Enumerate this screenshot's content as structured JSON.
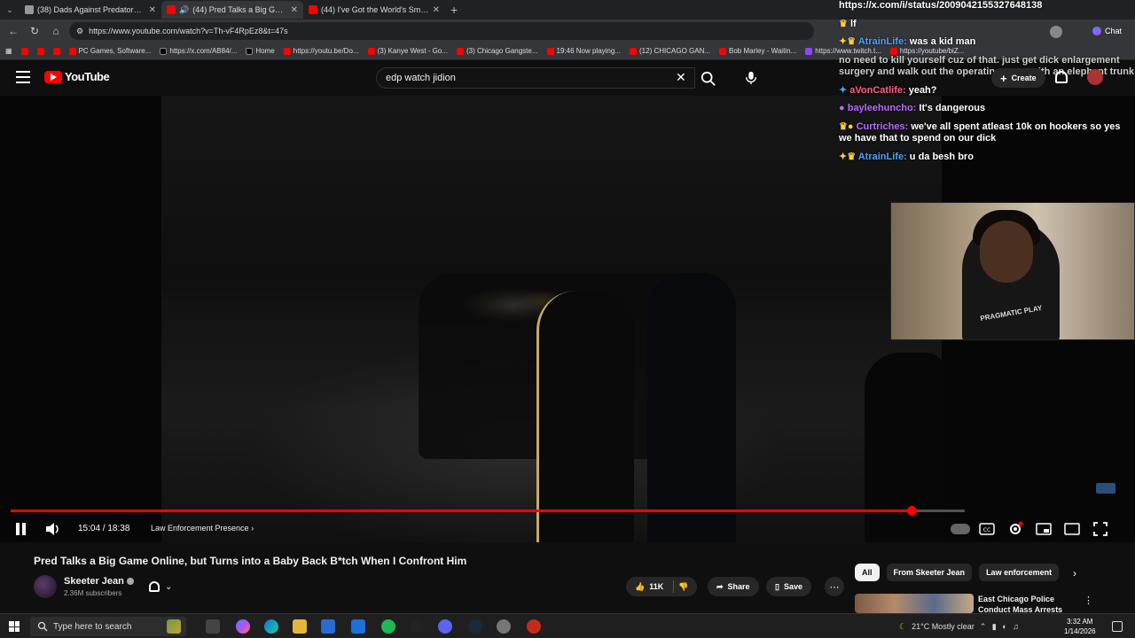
{
  "browser": {
    "tabs": [
      {
        "title": "(38) Dads Against Predators Con",
        "active": false
      },
      {
        "title": "(44) Pred Talks a Big Game O",
        "active": true
      },
      {
        "title": "(44) I've Got the World's Smallest",
        "active": false
      }
    ],
    "url": "https://www.youtube.com/watch?v=Th-vF4RpEz8&t=47s",
    "bookmarks": [
      "PC Games, Software...",
      "https://x.com/AB84/...",
      "Home",
      "https://youtu.be/Do...",
      "(3) Kanye West - Go...",
      "(3) Chicago Gangste...",
      "19:46 Now playing...",
      "(12) CHICAGO GAN...",
      "Bob Marley - Waitin...",
      "https://www.twitch.t...",
      "https://youtube/biZ..."
    ],
    "chat_button": "Chat"
  },
  "youtube": {
    "logo_text": "YouTube",
    "search_value": "edp watch jidion",
    "create_label": "Create"
  },
  "chat": {
    "link_line": "https://x.com/i/status/2009042155327648138",
    "messages": [
      {
        "user": "AtrainLife:",
        "text": "was a kid man",
        "color": "#4da3ff"
      },
      {
        "user": "",
        "text": "no need to kill yourself cuz of that. just get dick enlargement surgery and walk out the operating room with an elephant trunk",
        "color": "#ff5e8a"
      },
      {
        "user": "aVonCatlife:",
        "text": "yeah?",
        "color": "#ff5e8a"
      },
      {
        "user": "bayleehuncho:",
        "text": "It's dangerous",
        "color": "#b96bff"
      },
      {
        "user": "Curtriches:",
        "text": "we've all spent atleast 10k on hookers so yes we have that to spend on our dick",
        "color": "#b96bff"
      },
      {
        "user": "AtrainLife:",
        "text": "u da besh bro",
        "color": "#4da3ff"
      }
    ],
    "pre_lines": [
      "lf"
    ]
  },
  "webcam": {
    "shirt_text": "PRAGMATIC PLAY"
  },
  "player": {
    "time": "15:04 / 18:38",
    "chapter": "Law Enforcement Presence",
    "progress": 0.944
  },
  "video_info": {
    "title": "Pred Talks a Big Game Online, but Turns into a Baby Back B*tch When I Confront Him",
    "channel": "Skeeter Jean",
    "subscribers": "2.36M subscribers",
    "likes": "11K",
    "share_label": "Share",
    "save_label": "Save"
  },
  "sidebar": {
    "chips": [
      "All",
      "From Skeeter Jean",
      "Law enforcement"
    ],
    "recommended": {
      "title": "East Chicago Police Conduct Mass Arrests"
    }
  },
  "taskbar": {
    "search_placeholder": "Type here to search",
    "weather": "21°C  Mostly clear",
    "time": "3:32 AM",
    "date": "1/14/2026"
  },
  "colors": {
    "accent": "#ff0000",
    "background": "#0f0f0f"
  }
}
